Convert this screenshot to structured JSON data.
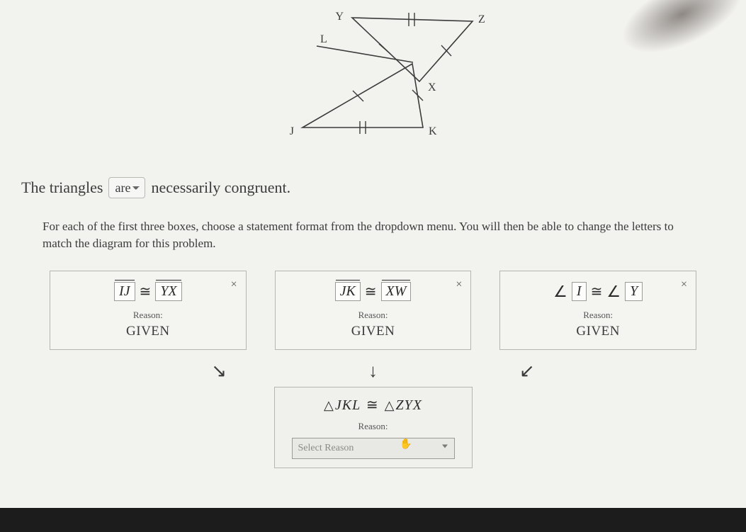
{
  "diagram": {
    "labels": {
      "Y": "Y",
      "Z": "Z",
      "X": "X",
      "L": "L",
      "J": "J",
      "K": "K"
    }
  },
  "sentence": {
    "prefix": "The triangles",
    "dropdown_value": "are",
    "suffix": "necessarily congruent."
  },
  "instructions": "For each of the first three boxes, choose a statement format from the dropdown menu. You will then be able to change the letters to match the diagram for this problem.",
  "cards": [
    {
      "left": "IJ",
      "right": "YX",
      "type": "segment",
      "reason_label": "Reason:",
      "reason": "GIVEN"
    },
    {
      "left": "JK",
      "right": "XW",
      "type": "segment",
      "reason_label": "Reason:",
      "reason": "GIVEN"
    },
    {
      "left": "I",
      "right": "Y",
      "type": "angle",
      "reason_label": "Reason:",
      "reason": "GIVEN"
    }
  ],
  "arrows": {
    "left": "↘",
    "mid": "↓",
    "right": "↙"
  },
  "conclusion": {
    "left_tri": "JKL",
    "right_tri": "ZYX",
    "reason_label": "Reason:",
    "select_placeholder": "Select Reason"
  },
  "symbols": {
    "congruent": "≅",
    "angle": "∠",
    "triangle": "△"
  }
}
